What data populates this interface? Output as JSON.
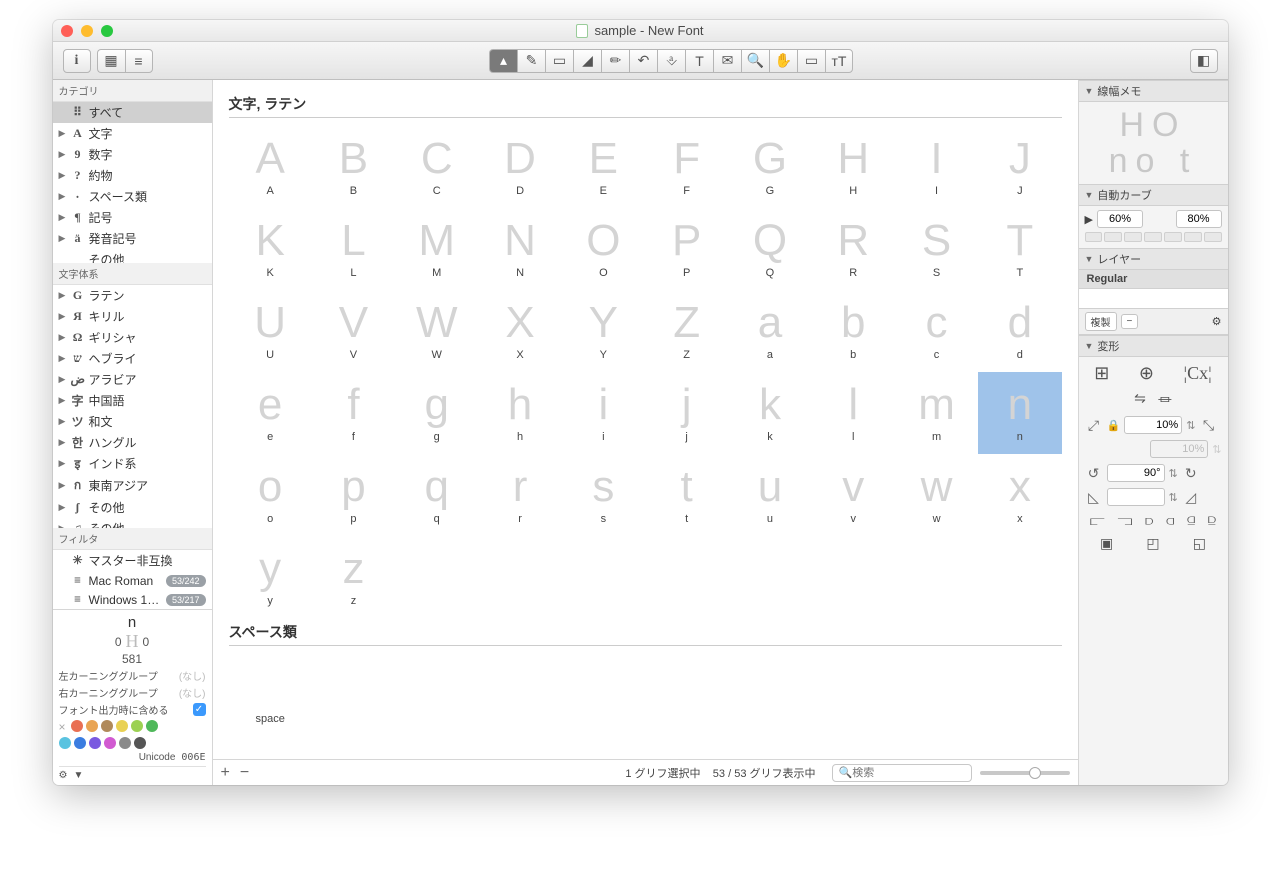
{
  "window": {
    "title": "sample - New Font"
  },
  "sidebar": {
    "header_categories": "カテゴリ",
    "items_cat": [
      {
        "icon": "⠿",
        "label": "すべて",
        "sel": true,
        "tri": ""
      },
      {
        "icon": "A",
        "label": "文字",
        "tri": "▶"
      },
      {
        "icon": "9",
        "label": "数字",
        "tri": "▶"
      },
      {
        "icon": "?",
        "label": "約物",
        "tri": "▶"
      },
      {
        "icon": "⸱",
        "label": "スペース類",
        "tri": "▶"
      },
      {
        "icon": "¶",
        "label": "記号",
        "tri": "▶"
      },
      {
        "icon": "ä",
        "label": "発音記号",
        "tri": "▶"
      },
      {
        "icon": "",
        "label": "その他",
        "tri": ""
      }
    ],
    "header_systems": "文字体系",
    "items_sys": [
      {
        "icon": "G",
        "label": "ラテン",
        "tri": "▶"
      },
      {
        "icon": "Я",
        "label": "キリル",
        "tri": "▶"
      },
      {
        "icon": "Ω",
        "label": "ギリシャ",
        "tri": "▶"
      },
      {
        "icon": "ש",
        "label": "ヘブライ",
        "tri": "▶"
      },
      {
        "icon": "ض",
        "label": "アラビア",
        "tri": "▶"
      },
      {
        "icon": "字",
        "label": "中国語",
        "tri": "▶"
      },
      {
        "icon": "ツ",
        "label": "和文",
        "tri": "▶"
      },
      {
        "icon": "한",
        "label": "ハングル",
        "tri": "▶"
      },
      {
        "icon": "इ",
        "label": "インド系",
        "tri": "▶"
      },
      {
        "icon": "ก",
        "label": "東南アジア",
        "tri": "▶"
      },
      {
        "icon": "ʃ",
        "label": "その他",
        "tri": "▶"
      },
      {
        "icon": "♫",
        "label": "その他",
        "tri": "▶"
      }
    ],
    "header_filters": "フィルタ",
    "items_filt": [
      {
        "icon": "✳",
        "label": "マスター非互換"
      },
      {
        "icon": "≡",
        "label": "Mac Roman",
        "badge": "53/242"
      },
      {
        "icon": "≡",
        "label": "Windows 1…",
        "badge": "53/217"
      }
    ]
  },
  "info": {
    "glyph_name": "n",
    "lsb": "0",
    "rsb": "0",
    "width": "581",
    "left_kern_label": "左カーニンググループ",
    "left_kern_val": "(なし)",
    "right_kern_label": "右カーニンググループ",
    "right_kern_val": "(なし)",
    "export_label": "フォント出力時に含める",
    "colors1": [
      "#e96f53",
      "#e9a453",
      "#b08a5a",
      "#e9d153",
      "#9cd153",
      "#4fb85a"
    ],
    "colors2": [
      "#5ac3e0",
      "#3b7de0",
      "#7a5ae0",
      "#d15ad1",
      "#8a8a8a",
      "#555555"
    ],
    "unicode_label": "Unicode",
    "unicode_value": "006E"
  },
  "main": {
    "section1": "文字, ラテン",
    "glyphs": [
      "A",
      "B",
      "C",
      "D",
      "E",
      "F",
      "G",
      "H",
      "I",
      "J",
      "K",
      "L",
      "M",
      "N",
      "O",
      "P",
      "Q",
      "R",
      "S",
      "T",
      "U",
      "V",
      "W",
      "X",
      "Y",
      "Z",
      "a",
      "b",
      "c",
      "d",
      "e",
      "f",
      "g",
      "h",
      "i",
      "j",
      "k",
      "l",
      "m",
      "n",
      "o",
      "p",
      "q",
      "r",
      "s",
      "t",
      "u",
      "v",
      "w",
      "x",
      "y",
      "z"
    ],
    "selected_glyph": "n",
    "section2": "スペース類",
    "space_label": "space",
    "status_sel": "1 グリフ選択中",
    "status_count": "53 / 53 グリフ表示中",
    "search_placeholder": "検索"
  },
  "rpanel": {
    "stroke_header": "線幅メモ",
    "stroke_u": "HO",
    "stroke_l": "no t",
    "autocurve_header": "自動カーブ",
    "curve_min": "60%",
    "curve_max": "80%",
    "layers_header": "レイヤー",
    "layer_name": "Regular",
    "dup_label": "複製",
    "transform_header": "変形",
    "scale_val": "10%",
    "scale_val2": "10%",
    "rotate_val": "90°"
  }
}
